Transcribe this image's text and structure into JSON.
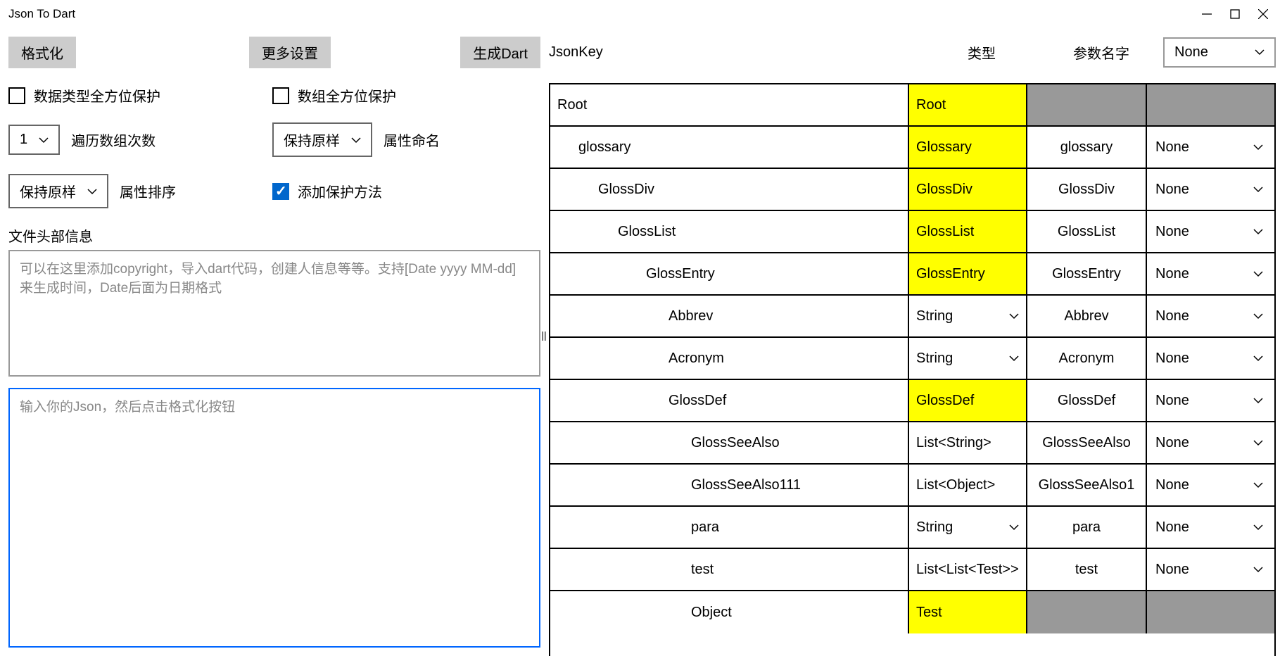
{
  "window": {
    "title": "Json To Dart"
  },
  "toolbar": {
    "format": "格式化",
    "moreSettings": "更多设置",
    "generate": "生成Dart"
  },
  "options": {
    "dataTypeProtect": "数据类型全方位保护",
    "arrayProtect": "数组全方位保护",
    "arrayIterCount": "1",
    "arrayIterLabel": "遍历数组次数",
    "propNaming": "保持原样",
    "propNamingLabel": "属性命名",
    "propSort": "保持原样",
    "propSortLabel": "属性排序",
    "addProtect": "添加保护方法",
    "fileHeaderLabel": "文件头部信息",
    "fileHeaderPlaceholder": "可以在这里添加copyright，导入dart代码，创建人信息等等。支持[Date yyyy MM-dd]来生成时间，Date后面为日期格式",
    "jsonPlaceholder": "输入你的Json，然后点击格式化按钮"
  },
  "rightHeader": {
    "jsonKey": "JsonKey",
    "type": "类型",
    "paramName": "参数名字",
    "noneSelect": "None"
  },
  "rows": [
    {
      "key": "Root",
      "indent": 0,
      "type": "Root",
      "typeStyle": "yellow",
      "param": "",
      "paramInactive": true,
      "none": "",
      "noneInactive": true
    },
    {
      "key": "glossary",
      "indent": 1,
      "type": "Glossary",
      "typeStyle": "yellow",
      "param": "glossary",
      "none": "None"
    },
    {
      "key": "GlossDiv",
      "indent": 2,
      "type": "GlossDiv",
      "typeStyle": "yellow",
      "param": "GlossDiv",
      "none": "None"
    },
    {
      "key": "GlossList",
      "indent": 3,
      "type": "GlossList",
      "typeStyle": "yellow",
      "param": "GlossList",
      "none": "None"
    },
    {
      "key": "GlossEntry",
      "indent": 4,
      "type": "GlossEntry",
      "typeStyle": "yellow",
      "param": "GlossEntry",
      "none": "None"
    },
    {
      "key": "Abbrev",
      "indent": 5,
      "type": "String",
      "typeStyle": "dropdown",
      "param": "Abbrev",
      "none": "None"
    },
    {
      "key": "Acronym",
      "indent": 5,
      "type": "String",
      "typeStyle": "dropdown",
      "param": "Acronym",
      "none": "None"
    },
    {
      "key": "GlossDef",
      "indent": 5,
      "type": "GlossDef",
      "typeStyle": "yellow",
      "param": "GlossDef",
      "none": "None"
    },
    {
      "key": "GlossSeeAlso",
      "indent": 6,
      "type": "List<String>",
      "typeStyle": "plain",
      "param": "GlossSeeAlso",
      "none": "None"
    },
    {
      "key": "GlossSeeAlso111",
      "indent": 6,
      "type": "List<Object>",
      "typeStyle": "plain",
      "param": "GlossSeeAlso1",
      "none": "None"
    },
    {
      "key": "para",
      "indent": 6,
      "type": "String",
      "typeStyle": "dropdown",
      "param": "para",
      "none": "None"
    },
    {
      "key": "test",
      "indent": 6,
      "type": "List<List<Test>>",
      "typeStyle": "plain",
      "param": "test",
      "none": "None"
    },
    {
      "key": "Object",
      "indent": 6,
      "type": "Test",
      "typeStyle": "yellow",
      "param": "",
      "paramInactive": true,
      "none": "",
      "noneInactive": true
    }
  ]
}
